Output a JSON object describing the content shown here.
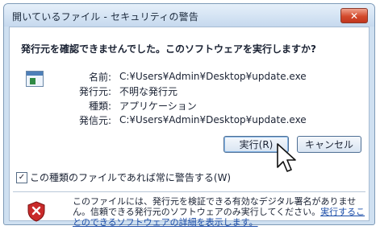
{
  "window": {
    "title": "開いているファイル - セキュリティの警告",
    "close_label": "✕"
  },
  "dialog": {
    "question": "発行元を確認できませんでした。このソフトウェアを実行しますか?",
    "details": [
      {
        "label": "名前:",
        "value": "C:¥Users¥Admin¥Desktop¥update.exe"
      },
      {
        "label": "発行元:",
        "value": "不明な発行元"
      },
      {
        "label": "種類:",
        "value": "アプリケーション"
      },
      {
        "label": "発信元:",
        "value": "C:¥Users¥Admin¥Desktop¥update.exe"
      }
    ],
    "buttons": {
      "run": "実行(R)",
      "cancel": "キャンセル"
    },
    "checkbox": {
      "label": "この種類のファイルであれば常に警告する(W)",
      "checked": true,
      "mark": "✓"
    },
    "warning": {
      "text": "このファイルには、発行元を検証できる有効なデジタル署名がありません。信頼できる発行元のソフトウェアのみ実行してください。",
      "link": "実行することのできるソフトウェアの詳細を表示します。"
    }
  },
  "icons": [
    "application-icon",
    "shield-warning-icon",
    "close-icon",
    "mouse-cursor-icon",
    "checkmark-icon"
  ]
}
